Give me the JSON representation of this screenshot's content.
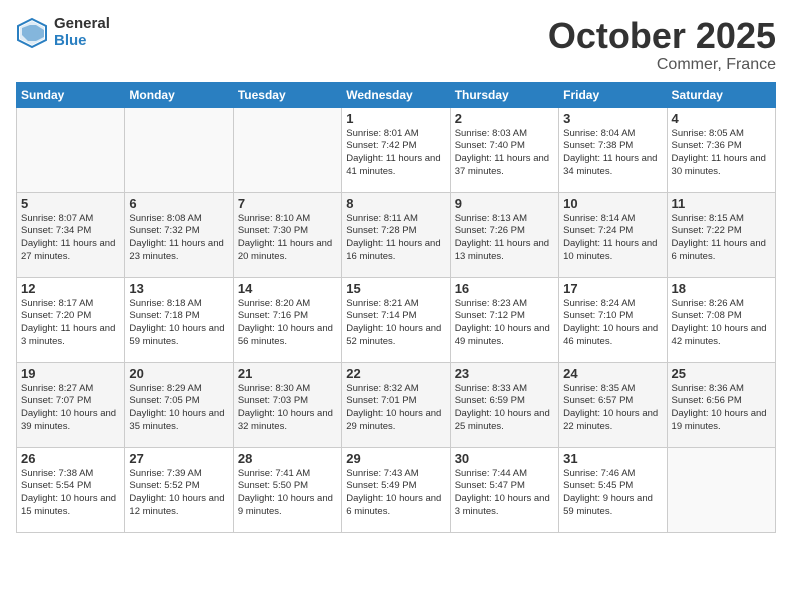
{
  "header": {
    "logo_general": "General",
    "logo_blue": "Blue",
    "month": "October 2025",
    "location": "Commer, France"
  },
  "weekdays": [
    "Sunday",
    "Monday",
    "Tuesday",
    "Wednesday",
    "Thursday",
    "Friday",
    "Saturday"
  ],
  "weeks": [
    [
      {
        "day": "",
        "info": ""
      },
      {
        "day": "",
        "info": ""
      },
      {
        "day": "",
        "info": ""
      },
      {
        "day": "1",
        "info": "Sunrise: 8:01 AM\nSunset: 7:42 PM\nDaylight: 11 hours\nand 41 minutes."
      },
      {
        "day": "2",
        "info": "Sunrise: 8:03 AM\nSunset: 7:40 PM\nDaylight: 11 hours\nand 37 minutes."
      },
      {
        "day": "3",
        "info": "Sunrise: 8:04 AM\nSunset: 7:38 PM\nDaylight: 11 hours\nand 34 minutes."
      },
      {
        "day": "4",
        "info": "Sunrise: 8:05 AM\nSunset: 7:36 PM\nDaylight: 11 hours\nand 30 minutes."
      }
    ],
    [
      {
        "day": "5",
        "info": "Sunrise: 8:07 AM\nSunset: 7:34 PM\nDaylight: 11 hours\nand 27 minutes."
      },
      {
        "day": "6",
        "info": "Sunrise: 8:08 AM\nSunset: 7:32 PM\nDaylight: 11 hours\nand 23 minutes."
      },
      {
        "day": "7",
        "info": "Sunrise: 8:10 AM\nSunset: 7:30 PM\nDaylight: 11 hours\nand 20 minutes."
      },
      {
        "day": "8",
        "info": "Sunrise: 8:11 AM\nSunset: 7:28 PM\nDaylight: 11 hours\nand 16 minutes."
      },
      {
        "day": "9",
        "info": "Sunrise: 8:13 AM\nSunset: 7:26 PM\nDaylight: 11 hours\nand 13 minutes."
      },
      {
        "day": "10",
        "info": "Sunrise: 8:14 AM\nSunset: 7:24 PM\nDaylight: 11 hours\nand 10 minutes."
      },
      {
        "day": "11",
        "info": "Sunrise: 8:15 AM\nSunset: 7:22 PM\nDaylight: 11 hours\nand 6 minutes."
      }
    ],
    [
      {
        "day": "12",
        "info": "Sunrise: 8:17 AM\nSunset: 7:20 PM\nDaylight: 11 hours\nand 3 minutes."
      },
      {
        "day": "13",
        "info": "Sunrise: 8:18 AM\nSunset: 7:18 PM\nDaylight: 10 hours\nand 59 minutes."
      },
      {
        "day": "14",
        "info": "Sunrise: 8:20 AM\nSunset: 7:16 PM\nDaylight: 10 hours\nand 56 minutes."
      },
      {
        "day": "15",
        "info": "Sunrise: 8:21 AM\nSunset: 7:14 PM\nDaylight: 10 hours\nand 52 minutes."
      },
      {
        "day": "16",
        "info": "Sunrise: 8:23 AM\nSunset: 7:12 PM\nDaylight: 10 hours\nand 49 minutes."
      },
      {
        "day": "17",
        "info": "Sunrise: 8:24 AM\nSunset: 7:10 PM\nDaylight: 10 hours\nand 46 minutes."
      },
      {
        "day": "18",
        "info": "Sunrise: 8:26 AM\nSunset: 7:08 PM\nDaylight: 10 hours\nand 42 minutes."
      }
    ],
    [
      {
        "day": "19",
        "info": "Sunrise: 8:27 AM\nSunset: 7:07 PM\nDaylight: 10 hours\nand 39 minutes."
      },
      {
        "day": "20",
        "info": "Sunrise: 8:29 AM\nSunset: 7:05 PM\nDaylight: 10 hours\nand 35 minutes."
      },
      {
        "day": "21",
        "info": "Sunrise: 8:30 AM\nSunset: 7:03 PM\nDaylight: 10 hours\nand 32 minutes."
      },
      {
        "day": "22",
        "info": "Sunrise: 8:32 AM\nSunset: 7:01 PM\nDaylight: 10 hours\nand 29 minutes."
      },
      {
        "day": "23",
        "info": "Sunrise: 8:33 AM\nSunset: 6:59 PM\nDaylight: 10 hours\nand 25 minutes."
      },
      {
        "day": "24",
        "info": "Sunrise: 8:35 AM\nSunset: 6:57 PM\nDaylight: 10 hours\nand 22 minutes."
      },
      {
        "day": "25",
        "info": "Sunrise: 8:36 AM\nSunset: 6:56 PM\nDaylight: 10 hours\nand 19 minutes."
      }
    ],
    [
      {
        "day": "26",
        "info": "Sunrise: 7:38 AM\nSunset: 5:54 PM\nDaylight: 10 hours\nand 15 minutes."
      },
      {
        "day": "27",
        "info": "Sunrise: 7:39 AM\nSunset: 5:52 PM\nDaylight: 10 hours\nand 12 minutes."
      },
      {
        "day": "28",
        "info": "Sunrise: 7:41 AM\nSunset: 5:50 PM\nDaylight: 10 hours\nand 9 minutes."
      },
      {
        "day": "29",
        "info": "Sunrise: 7:43 AM\nSunset: 5:49 PM\nDaylight: 10 hours\nand 6 minutes."
      },
      {
        "day": "30",
        "info": "Sunrise: 7:44 AM\nSunset: 5:47 PM\nDaylight: 10 hours\nand 3 minutes."
      },
      {
        "day": "31",
        "info": "Sunrise: 7:46 AM\nSunset: 5:45 PM\nDaylight: 9 hours\nand 59 minutes."
      },
      {
        "day": "",
        "info": ""
      }
    ]
  ]
}
